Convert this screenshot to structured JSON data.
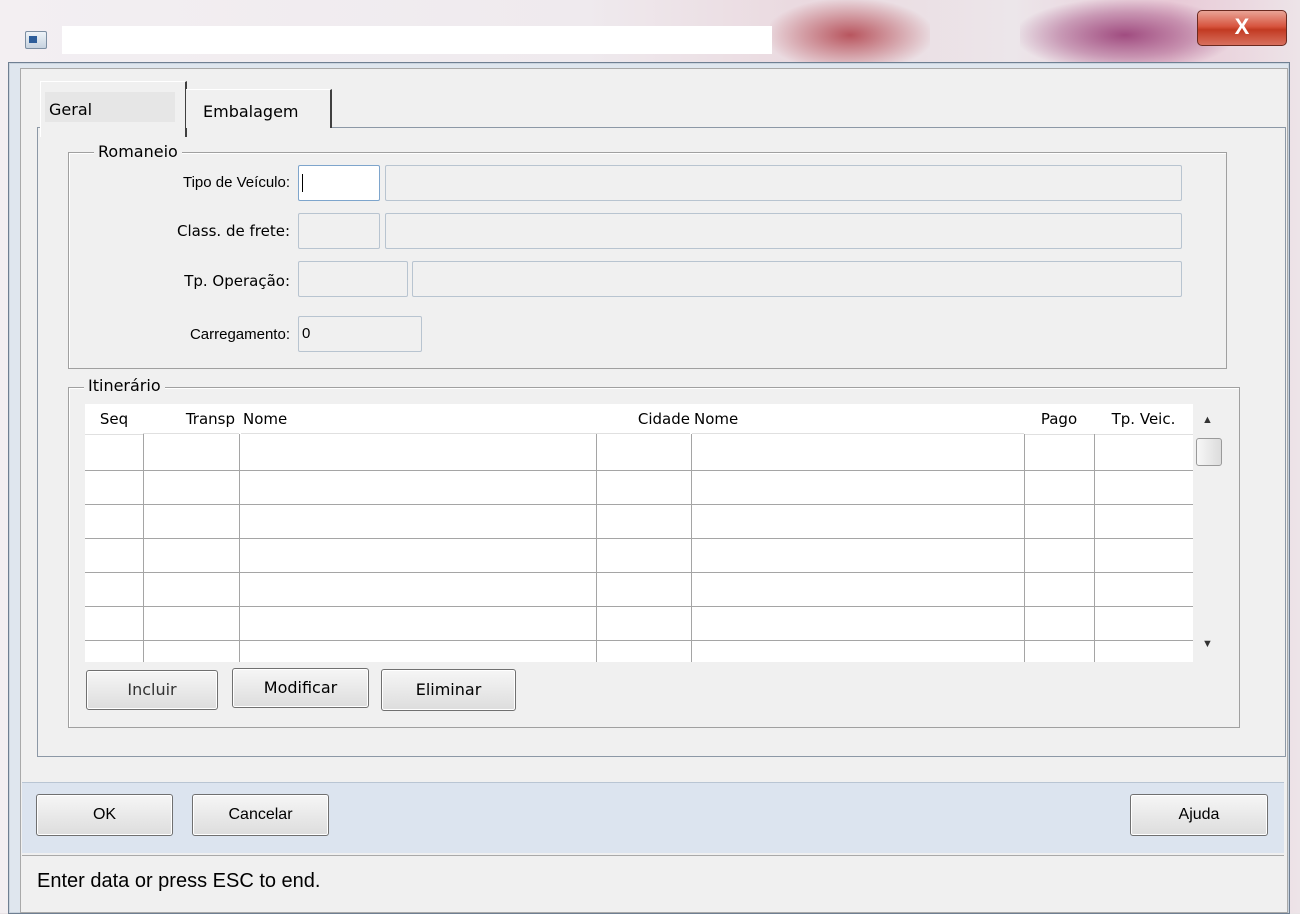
{
  "window": {
    "title": "",
    "close_label": "X"
  },
  "tabs": [
    {
      "label": "Geral",
      "selected": true
    },
    {
      "label": "Embalagem",
      "selected": false
    }
  ],
  "romaneio": {
    "legend": "Romaneio",
    "fields": {
      "tipo_veiculo": {
        "label": "Tipo de Veículo:",
        "code": "",
        "desc": ""
      },
      "class_frete": {
        "label": "Class. de frete:",
        "code": "",
        "desc": ""
      },
      "tp_operacao": {
        "label": "Tp. Operação:",
        "code": "",
        "desc": ""
      },
      "carregamento": {
        "label": "Carregamento:",
        "value": "0"
      }
    }
  },
  "itinerario": {
    "legend": "Itinerário",
    "columns": [
      "Seq",
      "Transp",
      "Nome",
      "Cidade",
      "Nome",
      "Pago",
      "Tp. Veic."
    ],
    "rows": [],
    "buttons": {
      "incluir": "Incluir",
      "modificar": "Modificar",
      "eliminar": "Eliminar"
    }
  },
  "footer": {
    "ok": "OK",
    "cancelar": "Cancelar",
    "ajuda": "Ajuda"
  },
  "status_text": "Enter data or press ESC to end."
}
